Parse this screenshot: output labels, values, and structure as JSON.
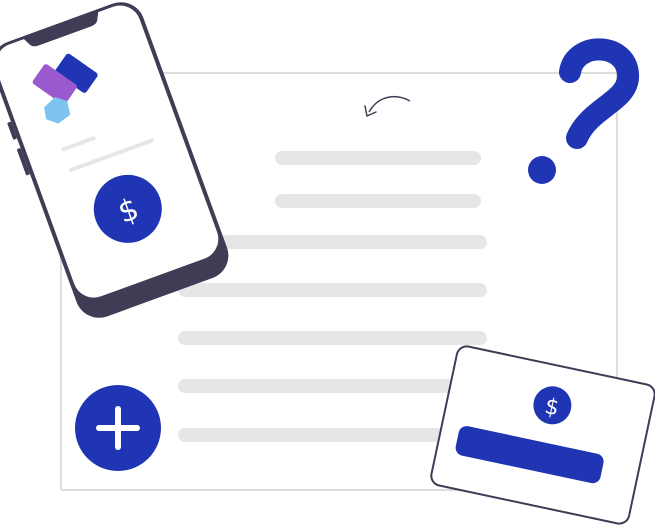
{
  "currency_symbol": "$",
  "plus_symbol": "+",
  "colors": {
    "primary": "#1f35b4",
    "dark": "#3f3d56",
    "skeleton": "#e6e6e6",
    "frame": "#dcdcdc",
    "purple": "#9b59d0",
    "light_blue": "#7ec3f0",
    "white": "#ffffff"
  },
  "icons": {
    "back": "curved-arrow-icon",
    "help": "question-mark-icon",
    "add": "plus-icon",
    "money": "dollar-icon"
  }
}
